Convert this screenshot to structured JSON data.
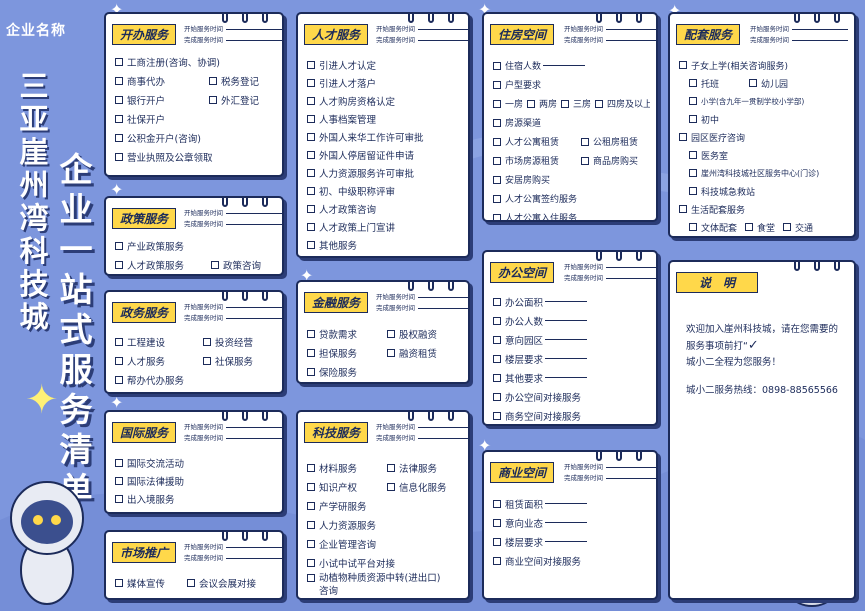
{
  "header": {
    "company_name": "企业名称",
    "park_name": "三亚崖州湾科技城",
    "title": "企业一站式服务清单"
  },
  "meta": {
    "start": "开始服务时间",
    "end": "完成服务时间"
  },
  "cards": {
    "kaiban": {
      "label": "开办服务",
      "rows": [
        [
          "工商注册(咨询、协调)"
        ],
        [
          "商事代办",
          "税务登记"
        ],
        [
          "银行开户",
          "外汇登记"
        ],
        [
          "社保开户"
        ],
        [
          "公积金开户(咨询)"
        ],
        [
          "营业执照及公章领取"
        ]
      ]
    },
    "zhengce": {
      "label": "政策服务",
      "rows": [
        [
          "产业政策服务"
        ],
        [
          "人才政策服务",
          "政策咨询"
        ]
      ]
    },
    "zhengwu": {
      "label": "政务服务",
      "rows": [
        [
          "工程建设",
          "投资经营"
        ],
        [
          "人才服务",
          "社保服务"
        ],
        [
          "帮办代办服务"
        ]
      ]
    },
    "guoji": {
      "label": "国际服务",
      "rows": [
        [
          "国际交流活动"
        ],
        [
          "国际法律援助"
        ],
        [
          "出入境服务"
        ]
      ]
    },
    "shichang": {
      "label": "市场推广",
      "rows": [
        [
          "媒体宣传",
          "会议会展对接"
        ]
      ]
    },
    "rencai": {
      "label": "人才服务",
      "rows": [
        [
          "引进人才认定"
        ],
        [
          "引进人才落户"
        ],
        [
          "人才购房资格认定"
        ],
        [
          "人事档案管理"
        ],
        [
          "外国人来华工作许可审批"
        ],
        [
          "外国人停居留证件申请"
        ],
        [
          "人力资源服务许可审批"
        ],
        [
          "初、中级职称评审"
        ],
        [
          "人才政策咨询"
        ],
        [
          "人才政策上门宣讲"
        ],
        [
          "其他服务"
        ]
      ]
    },
    "jinrong": {
      "label": "金融服务",
      "rows": [
        [
          "贷款需求",
          "股权融资"
        ],
        [
          "担保服务",
          "融资租赁"
        ],
        [
          "保险服务"
        ]
      ]
    },
    "keji": {
      "label": "科技服务",
      "rows": [
        [
          "材料服务",
          "法律服务"
        ],
        [
          "知识产权",
          "信息化服务"
        ],
        [
          "产学研服务"
        ],
        [
          "人力资源服务"
        ],
        [
          "企业管理咨询"
        ],
        [
          "小试中试平台对接"
        ],
        [
          "动植物种质资源中转(进出口)咨询"
        ]
      ]
    },
    "zhufang": {
      "label": "住房空间",
      "rows": [
        [
          "住宿人数"
        ],
        [
          "户型要求"
        ],
        [
          "一房",
          "两房",
          "三房",
          "四房及以上"
        ],
        [
          "房源渠道"
        ],
        [
          "人才公寓租赁",
          "公租房租赁"
        ],
        [
          "市场房源租赁",
          "商品房购买"
        ],
        [
          "安居房购买"
        ],
        [
          "人才公寓签约服务"
        ],
        [
          "人才公寓入住服务"
        ]
      ]
    },
    "bangong": {
      "label": "办公空间",
      "rows": [
        [
          "办公面积"
        ],
        [
          "办公人数"
        ],
        [
          "意向园区"
        ],
        [
          "楼层要求"
        ],
        [
          "其他要求"
        ],
        [
          "办公空间对接服务"
        ],
        [
          "商务空间对接服务"
        ]
      ]
    },
    "shangye": {
      "label": "商业空间",
      "rows": [
        [
          "租赁面积"
        ],
        [
          "意向业态"
        ],
        [
          "楼层要求"
        ],
        [
          "商业空间对接服务"
        ]
      ]
    },
    "peitao": {
      "label": "配套服务",
      "rows": [
        [
          "子女上学(相关咨询服务)"
        ],
        [
          "托班",
          "幼儿园"
        ],
        [
          "小学(含九年一贯制学校小学部)"
        ],
        [
          "初中"
        ],
        [
          "园区医疗咨询"
        ],
        [
          "医务室"
        ],
        [
          "崖州湾科技城社区服务中心(门诊)"
        ],
        [
          "科技城急救站"
        ],
        [
          "生活配套服务"
        ],
        [
          "文体配套",
          "食堂",
          "交通"
        ]
      ]
    },
    "shuoming": {
      "label": "说　明"
    }
  },
  "note": {
    "line1": "欢迎加入崖州科技城，请在您需要的服务事项前打“",
    "line2": "城小二全程为您服务！",
    "hotline": "城小二服务热线：0898-88565566"
  },
  "colors": {
    "bg": "#7d96dd",
    "accent": "#ffd84a",
    "ink": "#1c2b5a"
  }
}
